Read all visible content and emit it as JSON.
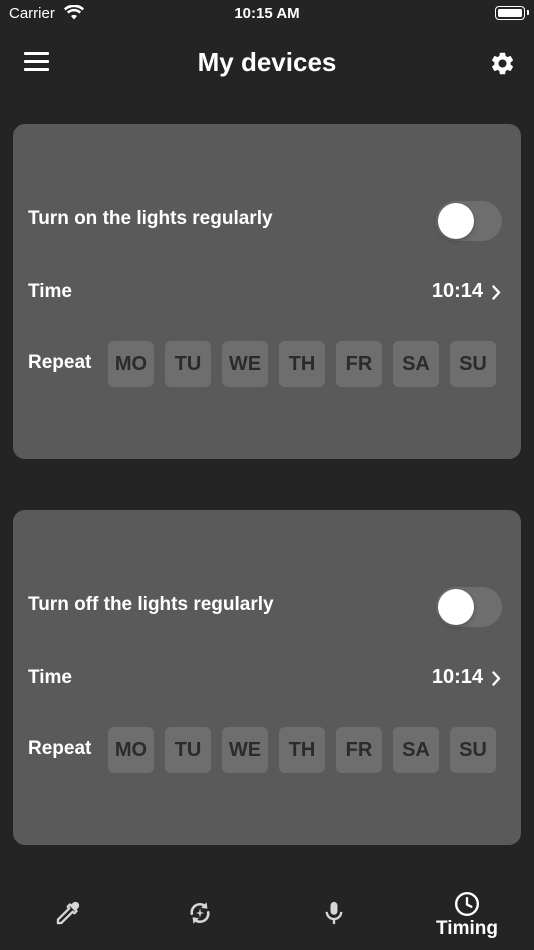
{
  "status_bar": {
    "carrier": "Carrier",
    "time": "10:15 AM"
  },
  "nav": {
    "title": "My devices"
  },
  "cards": [
    {
      "toggle_label": "Turn on the lights regularly",
      "toggle_on": false,
      "time_label": "Time",
      "time_value": "10:14",
      "repeat_label": "Repeat",
      "days": [
        "MO",
        "TU",
        "WE",
        "TH",
        "FR",
        "SA",
        "SU"
      ]
    },
    {
      "toggle_label": "Turn off the lights regularly",
      "toggle_on": false,
      "time_label": "Time",
      "time_value": "10:14",
      "repeat_label": "Repeat",
      "days": [
        "MO",
        "TU",
        "WE",
        "TH",
        "FR",
        "SA",
        "SU"
      ]
    }
  ],
  "tab_bar": {
    "tabs": [
      {
        "icon": "eyedropper-icon",
        "label": ""
      },
      {
        "icon": "sync-icon",
        "label": ""
      },
      {
        "icon": "microphone-icon",
        "label": ""
      },
      {
        "icon": "clock-icon",
        "label": "Timing",
        "active": true
      }
    ]
  },
  "colors": {
    "background": "#242424",
    "card": "#5a5a5a",
    "day_chip": "#6e6e6e",
    "toggle_off": "#6e6e6e",
    "text": "#ffffff",
    "day_text": "#2b2b2b"
  }
}
